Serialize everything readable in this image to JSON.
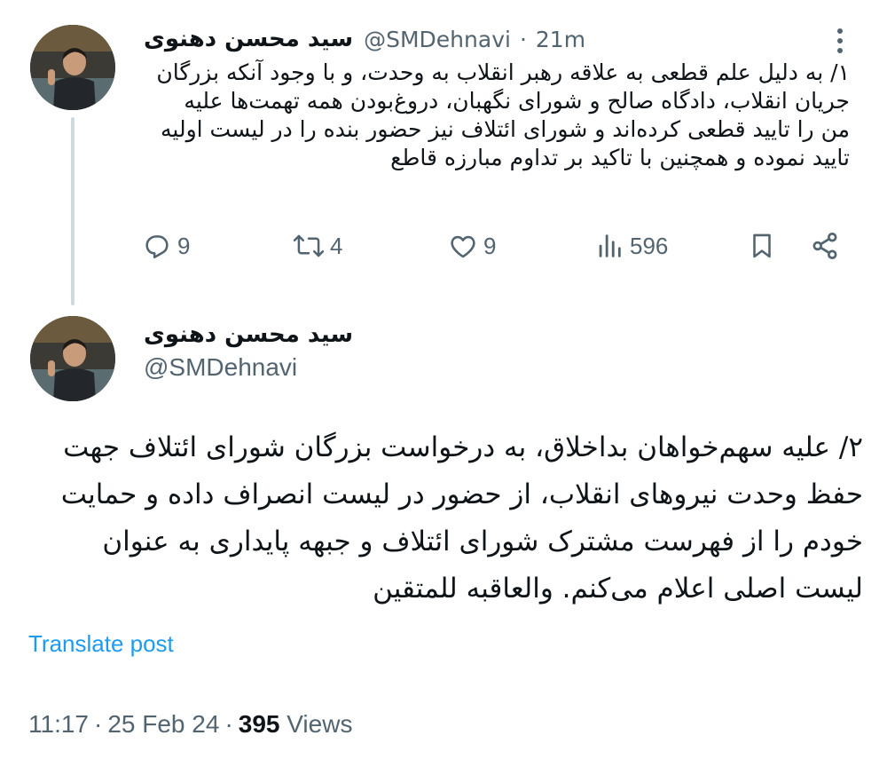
{
  "tweet1": {
    "display_name": "سید محسن دهنوی",
    "handle": "@SMDehnavi",
    "separator": "·",
    "time": "21m",
    "text": "۱/ به دلیل علم قطعی به علاقه رهبر انقلاب به وحدت، و با وجود آنکه بزرگان جریان انقلاب، دادگاه صالح و شورای نگهبان، دروغ‌بودن همه تهمت‌ها علیه من را تایید قطعی کرده‌اند و شورای ائتلاف نیز حضور بنده را در لیست اولیه تایید نموده و همچنین با تاکید بر تداوم مبارزه قاطع",
    "replies": "9",
    "reposts": "4",
    "likes": "9",
    "views": "596",
    "icons": [
      "reply-icon",
      "repost-icon",
      "like-icon",
      "views-icon",
      "bookmark-icon",
      "share-icon",
      "more-icon"
    ]
  },
  "tweet2": {
    "display_name": "سید محسن دهنوی",
    "handle": "@SMDehnavi",
    "text": "۲/ علیه سهم‌خواهان بداخلاق، به درخواست بزرگان شورای ائتلاف جهت حفظ وحدت نیروهای انقلاب، از حضور در لیست انصراف داده و حمایت خودم را از فهرست مشترک شورای ائتلاف و جبهه پایداری به عنوان لیست اصلی اعلام می‌کنم. والعاقبه للمتقین",
    "translate_label": "Translate post",
    "time": "11:17",
    "date": "25 Feb 24",
    "separator": "·",
    "views_count": "395",
    "views_label": "Views"
  },
  "colors": {
    "text": "#0f1419",
    "secondary": "#536471",
    "link": "#1d9bf0",
    "thread_line": "#cfd9de"
  }
}
